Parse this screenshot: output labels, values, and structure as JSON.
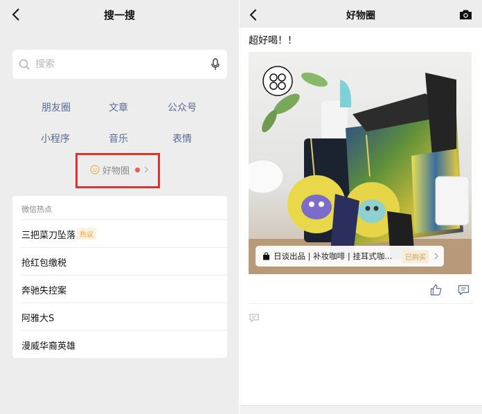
{
  "left": {
    "nav": {
      "title": "搜一搜"
    },
    "search": {
      "placeholder": "搜索",
      "value": ""
    },
    "categories": [
      "朋友圈",
      "文章",
      "公众号",
      "小程序",
      "音乐",
      "表情"
    ],
    "haowu": {
      "label": "好物圈"
    },
    "hot": {
      "header": "微信热点",
      "items": [
        {
          "text": "三把菜刀坠落",
          "badge": "热议"
        },
        {
          "text": "抢红包缴税"
        },
        {
          "text": "奔驰失控案"
        },
        {
          "text": "阿雅大S"
        },
        {
          "text": "漫威华裔英雄"
        }
      ]
    }
  },
  "right": {
    "nav": {
      "title": "好物圈"
    },
    "post": {
      "text": "超好喝！！",
      "product": {
        "name": "日谈出品 | 补妆咖啡 | 挂耳式咖...",
        "badge": "已购买"
      }
    }
  },
  "colors": {
    "link_blue": "#576b95",
    "highlight_red": "#d9332b",
    "dot_red": "#fa5151",
    "hot_orange": "#fa9d3b",
    "bought_gold": "#c8a15a",
    "panel_gray": "#ededed"
  },
  "icons": [
    "back-arrow-icon",
    "search-icon",
    "microphone-icon",
    "haowu-icon",
    "chevron-right-icon",
    "camera-icon",
    "shopping-bag-icon",
    "thumbs-up-icon",
    "comment-icon"
  ]
}
